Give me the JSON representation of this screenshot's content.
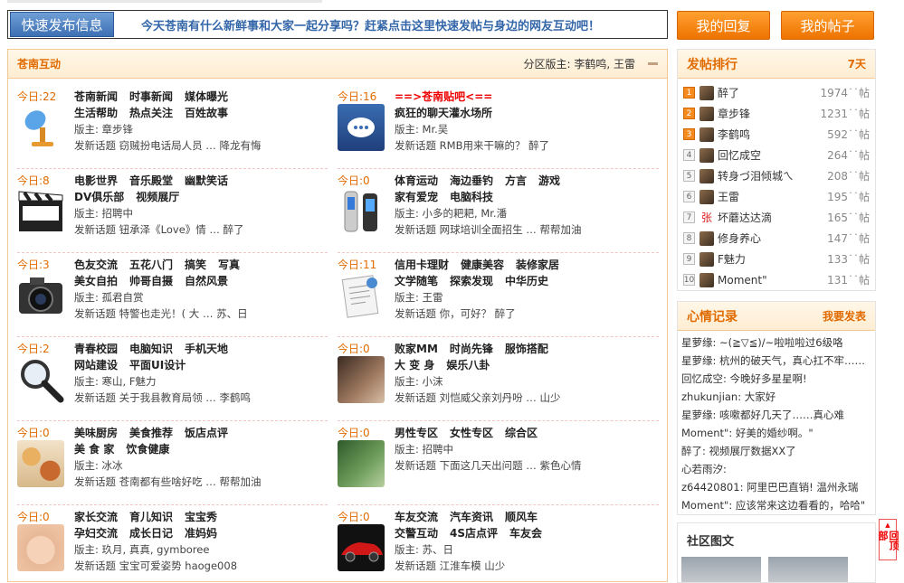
{
  "quickpost": {
    "button": "快速发布信息",
    "message": "今天苍南有什么新鲜事和大家一起分享吗？赶紧点击这里快速发帖与身边的网友互动吧！"
  },
  "my_replies": "我的回复",
  "my_posts": "我的帖子",
  "main": {
    "title": "苍南互动",
    "moderators_label": "分区版主:",
    "moderators": "李鹤鸣, 王雷"
  },
  "forums": [
    {
      "today": "今日:22",
      "links": [
        "苍南新闻",
        "时事新闻",
        "媒体曝光",
        "生活帮助",
        "热点关注",
        "百姓故事"
      ],
      "mod": "版主: 章步锋",
      "latest": "发新话题 窃贼扮电话局人员 … 降龙有悔",
      "icon": "microphone-icon"
    },
    {
      "today": "今日:16",
      "links": [
        "==>苍南贴吧<=="
      ],
      "links2": [
        "疯狂的聊天灌水场所"
      ],
      "mod": "版主: Mr.吴",
      "latest": "发新话题 RMB用来干嘛的？ 醉了",
      "icon": "chat-bubble-icon"
    },
    {
      "today": "今日:8",
      "links": [
        "电影世界",
        "音乐殿堂",
        "幽默笑话",
        "DV俱乐部",
        "视频展厅"
      ],
      "mod": "版主: 招聘中",
      "latest": "发新话题 钮承泽《Love》情 … 醉了",
      "icon": "clapperboard-icon"
    },
    {
      "today": "今日:0",
      "links": [
        "体育运动",
        "海边垂钓",
        "方言",
        "游戏",
        "家有爱宠",
        "电脑科技"
      ],
      "mod": "版主: 小多的耙耙, Mr.潘",
      "latest": "发新话题 网球培训全面招生 … 帮帮加油",
      "icon": "mp3-player-icon"
    },
    {
      "today": "今日:3",
      "links": [
        "色友交流",
        "五花八门",
        "搞笑",
        "写真",
        "美女自拍",
        "帅哥自摄",
        "自然风景"
      ],
      "mod": "版主: 孤君自赏",
      "latest": "发新话题 特警也走光！( 大 … 苏、日",
      "icon": "camera-icon"
    },
    {
      "today": "今日:11",
      "links": [
        "信用卡理财",
        "健康美容",
        "装修家居",
        "文学随笔",
        "探索发现",
        "中华历史"
      ],
      "mod": "版主: 王雷",
      "latest": "发新话题 你，可好？ 醉了",
      "icon": "document-icon"
    },
    {
      "today": "今日:2",
      "links": [
        "青春校园",
        "电脑知识",
        "手机天地",
        "网站建设",
        "平面UI设计"
      ],
      "mod": "版主: 寒山, F魅力",
      "latest": "发新话题 关于我县教育局领 … 李鹤鸣",
      "icon": "magnifier-icon"
    },
    {
      "today": "今日:0",
      "links": [
        "败家MM",
        "时尚先锋",
        "服饰搭配",
        "大 变 身",
        "娱乐八卦"
      ],
      "mod": "版主: 小沫",
      "latest": "发新话题 刘恺威父亲刘丹吩 … 山少",
      "icon": "fashion-photo-icon"
    },
    {
      "today": "今日:0",
      "links": [
        "美味厨房",
        "美食推荐",
        "饭店点评",
        "美 食 家",
        "饮食健康"
      ],
      "mod": "版主: 冰冰",
      "latest": "发新话题 苍南都有些啥好吃 … 帮帮加油",
      "icon": "food-icon"
    },
    {
      "today": "今日:0",
      "links": [
        "男性专区",
        "女性专区",
        "综合区"
      ],
      "mod": "版主: 招聘中",
      "latest": "发新话题 下面这几天出问题 … 紫色心情",
      "icon": "couple-photo-icon"
    },
    {
      "today": "今日:0",
      "links": [
        "家长交流",
        "育儿知识",
        "宝宝秀",
        "孕妇交流",
        "成长日记",
        "准妈妈"
      ],
      "mod": "版主: 玖月, 真真, gymboree",
      "latest": "发新话题 宝宝可爱姿势 haoge008",
      "icon": "baby-photo-icon"
    },
    {
      "today": "今日:0",
      "links": [
        "车友交流",
        "汽车资讯",
        "顺风车",
        "交警互动",
        "4S店点评",
        "车友会"
      ],
      "mod": "版主: 苏、日",
      "latest": "发新话题 江淮车模 山少",
      "icon": "car-photo-icon"
    }
  ],
  "ranking": {
    "title": "发帖排行",
    "period": "7天",
    "unit": "帖",
    "items": [
      {
        "rank": "1",
        "name": "醉了",
        "count": "1974"
      },
      {
        "rank": "2",
        "name": "章步锋",
        "count": "1231"
      },
      {
        "rank": "3",
        "name": "李鹤鸣",
        "count": "592"
      },
      {
        "rank": "4",
        "name": "回忆成空",
        "count": "264"
      },
      {
        "rank": "5",
        "name": "转身づ泪倾城ㄟ",
        "count": "208"
      },
      {
        "rank": "6",
        "name": "王雷",
        "count": "195"
      },
      {
        "rank": "7",
        "name": "坏蘑达达滴",
        "count": "165",
        "avatar_text": "张"
      },
      {
        "rank": "8",
        "name": "修身养心",
        "count": "147"
      },
      {
        "rank": "9",
        "name": "F魅力",
        "count": "133"
      },
      {
        "rank": "10",
        "name": "Moment\"",
        "count": "131"
      }
    ]
  },
  "mood": {
    "title": "心情记录",
    "post_link": "我要发表",
    "items": [
      "星萝缘: ~(≧▽≦)/~啦啦啦过6级咯",
      "星萝缘: 杭州的破天气，真心扛不牢……",
      "回忆成空: 今晚好多星星啊!",
      "zhukunjian: 大家好",
      "星萝缘: 咳嗽都好几天了……真心难",
      "Moment\": 好美的婚纱啊。\"",
      "醉了: 视频展厅数据XX了",
      "心若雨汐:",
      "z64420801: 阿里巴巴直销! 温州永瑞",
      "Moment\": 应该常来这边看看的，哈哈\""
    ]
  },
  "gallery": {
    "title": "社区图文"
  },
  "back_to_top": "回顶部"
}
